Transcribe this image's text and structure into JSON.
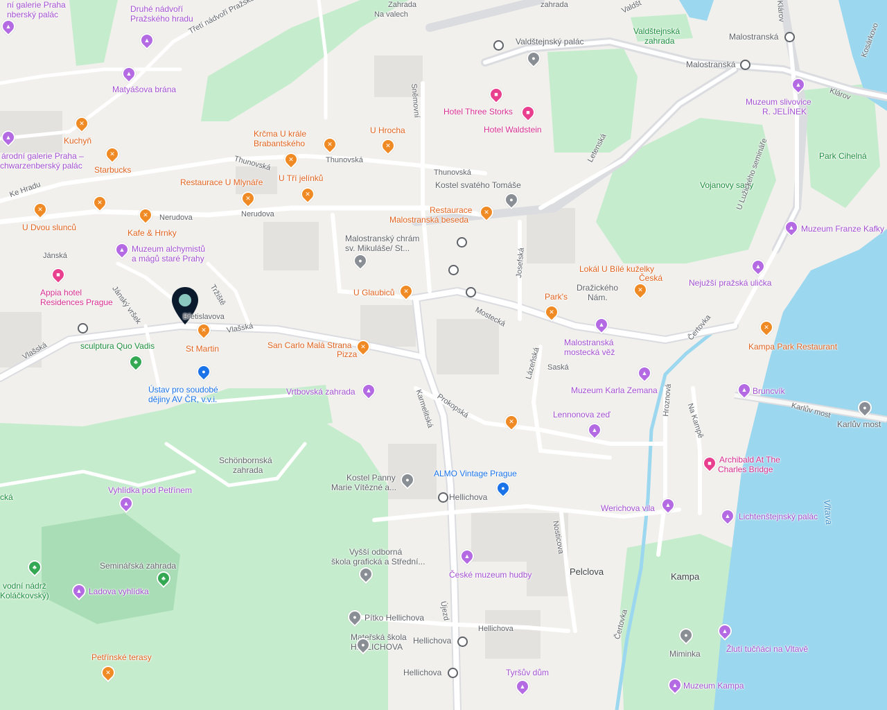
{
  "map": {
    "colors": {
      "land": "#f1f0ec",
      "park": "#c6ecce",
      "park_dark": "#a8ddb5",
      "water": "#9bd7ef",
      "road": "#ffffff",
      "road_major": "#dadce0",
      "building": "#e4e2de",
      "selected_pin": "#0b1a2c"
    },
    "labels": [
      {
        "text": "Zahrada",
        "cls": "street"
      },
      {
        "text": "Na valech",
        "cls": "street"
      },
      {
        "text": "zahrada",
        "cls": "street"
      },
      {
        "text": "Valdšt",
        "cls": "street"
      },
      {
        "text": "ní galerie Praha",
        "cls": "poi-museum"
      },
      {
        "text": "Druhé nádvoří",
        "cls": "poi-museum"
      },
      {
        "text": "Pražského hradu",
        "cls": "poi-museum"
      },
      {
        "text": "nberský palác",
        "cls": "poi-museum"
      },
      {
        "text": "Třetí nádvoří Pražského hradu",
        "cls": "street"
      },
      {
        "text": "Valdštejnský palác",
        "cls": "poi-gray"
      },
      {
        "text": "Valdštejnská",
        "cls": "poi-green"
      },
      {
        "text": "zahrada",
        "cls": "poi-green"
      },
      {
        "text": "Malostranská",
        "cls": "poi-gray"
      },
      {
        "text": "Malostranská",
        "cls": "poi-gray"
      },
      {
        "text": "Klárov",
        "cls": "street"
      },
      {
        "text": "Klárov",
        "cls": "street"
      },
      {
        "text": "Kosárkovo",
        "cls": "street"
      },
      {
        "text": "Muzeum slivovice",
        "cls": "poi-museum"
      },
      {
        "text": "R. JELÍNEK",
        "cls": "poi-museum"
      },
      {
        "text": "Matyášova brána",
        "cls": "poi-museum"
      },
      {
        "text": "Hotel Three Storks",
        "cls": "poi-hotel"
      },
      {
        "text": "Hotel Waldstein",
        "cls": "poi-hotel"
      },
      {
        "text": "Kuchyň",
        "cls": "poi-food"
      },
      {
        "text": "árodní galerie Praha –",
        "cls": "poi-museum"
      },
      {
        "text": "chwarzenberský palác",
        "cls": "poi-museum"
      },
      {
        "text": "Krčma U krále",
        "cls": "poi-food"
      },
      {
        "text": "Brabantského",
        "cls": "poi-food"
      },
      {
        "text": "U Hrocha",
        "cls": "poi-food"
      },
      {
        "text": "Sněmovní",
        "cls": "street"
      },
      {
        "text": "Starbucks",
        "cls": "poi-food"
      },
      {
        "text": "Thunovská",
        "cls": "street"
      },
      {
        "text": "Thunovská",
        "cls": "street"
      },
      {
        "text": "Thunovská",
        "cls": "street"
      },
      {
        "text": "Park Cihelná",
        "cls": "poi-green"
      },
      {
        "text": "Letenská",
        "cls": "street"
      },
      {
        "text": "Restaurace U Mlynáře",
        "cls": "poi-food"
      },
      {
        "text": "U Tří jelínků",
        "cls": "poi-food"
      },
      {
        "text": "Kostel svatého Tomáše",
        "cls": "poi-gray"
      },
      {
        "text": "Vojanovy sady",
        "cls": "poi-green"
      },
      {
        "text": "Ke Hradu",
        "cls": "street"
      },
      {
        "text": "U Lužického semináře",
        "cls": "street"
      },
      {
        "text": "Nerudova",
        "cls": "street"
      },
      {
        "text": "Nerudova",
        "cls": "street"
      },
      {
        "text": "Restaurace",
        "cls": "poi-food"
      },
      {
        "text": "Malostranská beseda",
        "cls": "poi-food"
      },
      {
        "text": "U Dvou slunců",
        "cls": "poi-food"
      },
      {
        "text": "Kafe & Hrnky",
        "cls": "poi-food"
      },
      {
        "text": "Muzeum Franze Kafky",
        "cls": "poi-museum"
      },
      {
        "text": "Malostranský chrám",
        "cls": "poi-gray"
      },
      {
        "text": "sv. Mikuláše/ St...",
        "cls": "poi-gray"
      },
      {
        "text": "Muzeum alchymistů",
        "cls": "poi-museum"
      },
      {
        "text": "a mágů staré Prahy",
        "cls": "poi-museum"
      },
      {
        "text": "Jánská",
        "cls": "street"
      },
      {
        "text": "Lokál U Bílé kuželky",
        "cls": "poi-food"
      },
      {
        "text": "Josefská",
        "cls": "street"
      },
      {
        "text": "Česká",
        "cls": "poi-food"
      },
      {
        "text": "Appia hotel",
        "cls": "poi-hotel"
      },
      {
        "text": "Residences Prague",
        "cls": "poi-hotel"
      },
      {
        "text": "Tržiště",
        "cls": "street"
      },
      {
        "text": "Nejužší pražská ulička",
        "cls": "poi-museum"
      },
      {
        "text": "Dražického",
        "cls": "poi-gray"
      },
      {
        "text": "Nám.",
        "cls": "poi-gray"
      },
      {
        "text": "Jánský vršek",
        "cls": "street"
      },
      {
        "text": "U Glaubiců",
        "cls": "poi-food"
      },
      {
        "text": "Park's",
        "cls": "poi-food"
      },
      {
        "text": "Mostecká",
        "cls": "street"
      },
      {
        "text": "Břetislavova",
        "cls": "street"
      },
      {
        "text": "Vlašská",
        "cls": "street"
      },
      {
        "text": "Čertovka",
        "cls": "street"
      },
      {
        "text": "Kampa Park Restaurant",
        "cls": "poi-food"
      },
      {
        "text": "St Martin",
        "cls": "poi-food"
      },
      {
        "text": "San Carlo Malá Strana",
        "cls": "poi-food"
      },
      {
        "text": "Pizza",
        "cls": "poi-food"
      },
      {
        "text": "Malostranská",
        "cls": "poi-museum"
      },
      {
        "text": "mostecká věž",
        "cls": "poi-museum"
      },
      {
        "text": "sculptura Quo Vadis",
        "cls": "poi-green"
      },
      {
        "text": "Vlašská",
        "cls": "street"
      },
      {
        "text": "Saská",
        "cls": "street"
      },
      {
        "text": "Ústav pro soudobé",
        "cls": "poi-shop"
      },
      {
        "text": "dějiny AV ČR, v.v.i.",
        "cls": "poi-shop"
      },
      {
        "text": "Muzeum Karla Zemana",
        "cls": "poi-museum"
      },
      {
        "text": "Bruncvík",
        "cls": "poi-museum"
      },
      {
        "text": "Karlův most",
        "cls": "street"
      },
      {
        "text": "Vrtbovská zahrada",
        "cls": "poi-museum"
      },
      {
        "text": "Karmelitská",
        "cls": "street"
      },
      {
        "text": "Prokopská",
        "cls": "street"
      },
      {
        "text": "Lázeňská",
        "cls": "street"
      },
      {
        "text": "Karlův most",
        "cls": "poi-gray"
      },
      {
        "text": "Lennonova zeď",
        "cls": "poi-museum"
      },
      {
        "text": "Na Kampě",
        "cls": "street"
      },
      {
        "text": "Hroznová",
        "cls": "street"
      },
      {
        "text": "Schönbornská",
        "cls": "poi-gray"
      },
      {
        "text": "zahrada",
        "cls": "poi-gray"
      },
      {
        "text": "Archibald At The",
        "cls": "poi-hotel"
      },
      {
        "text": "Charles Bridge",
        "cls": "poi-hotel"
      },
      {
        "text": "Kostel Panny",
        "cls": "poi-gray"
      },
      {
        "text": "Marie Vítězné a...",
        "cls": "poi-gray"
      },
      {
        "text": "ALMO Vintage Prague",
        "cls": "poi-shop"
      },
      {
        "text": "Vyhlídka pod Petřínem",
        "cls": "poi-museum"
      },
      {
        "text": "Hellichova",
        "cls": "poi-gray"
      },
      {
        "text": "Vltava",
        "cls": "water-label"
      },
      {
        "text": "Werichova vila",
        "cls": "poi-museum"
      },
      {
        "text": "Lichtenštejnský palác",
        "cls": "poi-museum"
      },
      {
        "text": "Nosticova",
        "cls": "street"
      },
      {
        "text": "Vyšší odborná",
        "cls": "poi-gray"
      },
      {
        "text": "škola grafická a Střední...",
        "cls": "poi-gray"
      },
      {
        "text": "Seminářská zahrada",
        "cls": "poi-gray"
      },
      {
        "text": "České muzeum hudby",
        "cls": "poi-museum"
      },
      {
        "text": "Pelclova",
        "cls": "district"
      },
      {
        "text": "Kampa",
        "cls": "district"
      },
      {
        "text": "vodní nádrž",
        "cls": "poi-green"
      },
      {
        "text": "Koláčkovský)",
        "cls": "poi-green"
      },
      {
        "text": "Ladova vyhlídka",
        "cls": "poi-museum"
      },
      {
        "text": "Újezd",
        "cls": "street"
      },
      {
        "text": "Pítko Hellichova",
        "cls": "poi-gray"
      },
      {
        "text": "Hellichova",
        "cls": "street"
      },
      {
        "text": "Mateřská škola",
        "cls": "poi-gray"
      },
      {
        "text": "HELLICHOVA",
        "cls": "poi-gray"
      },
      {
        "text": "Hellichova",
        "cls": "poi-gray"
      },
      {
        "text": "Čertovka",
        "cls": "street"
      },
      {
        "text": "Miminka",
        "cls": "poi-gray"
      },
      {
        "text": "Žlutí tučňáci na Vltavě",
        "cls": "poi-museum"
      },
      {
        "text": "Petřínské terasy",
        "cls": "poi-food"
      },
      {
        "text": "Hellichova",
        "cls": "poi-gray"
      },
      {
        "text": "Tyršův dům",
        "cls": "poi-museum"
      },
      {
        "text": "Muzeum Kampa",
        "cls": "poi-museum"
      },
      {
        "text": "cká",
        "cls": "poi-green"
      }
    ],
    "pins": [
      {
        "type": "food",
        "icon": "fork-knife-icon",
        "glyph": "✕"
      },
      {
        "type": "museum",
        "icon": "museum-icon",
        "glyph": "▲"
      },
      {
        "type": "hotel",
        "icon": "bed-icon",
        "glyph": "■"
      },
      {
        "type": "shop",
        "icon": "lock-icon",
        "glyph": "●"
      },
      {
        "type": "gray",
        "icon": "place-icon",
        "glyph": "●"
      },
      {
        "type": "green",
        "icon": "tree-icon",
        "glyph": "♣"
      }
    ]
  }
}
